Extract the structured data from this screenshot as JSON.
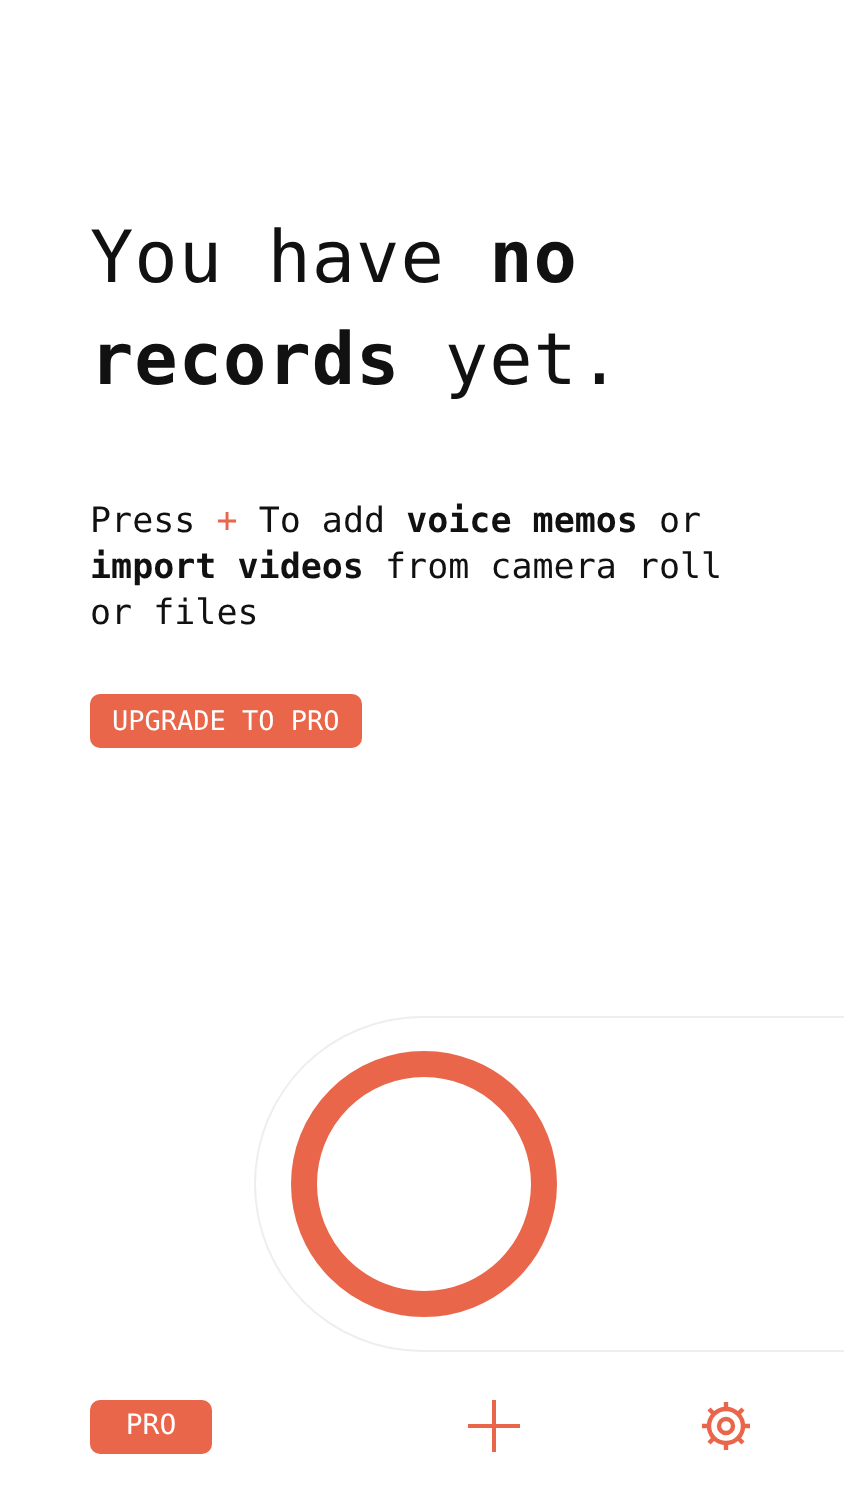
{
  "heading": "You have **no records** yet.",
  "instructions": {
    "before": "Press",
    "plus": "+",
    "after": "To add **voice memos** or **import videos** from camera roll or files"
  },
  "upgrade_button": "UPGRADE TO PRO",
  "recorder": {
    "recording": false
  },
  "bottom_bar": {
    "pro_button": "PRO"
  }
}
